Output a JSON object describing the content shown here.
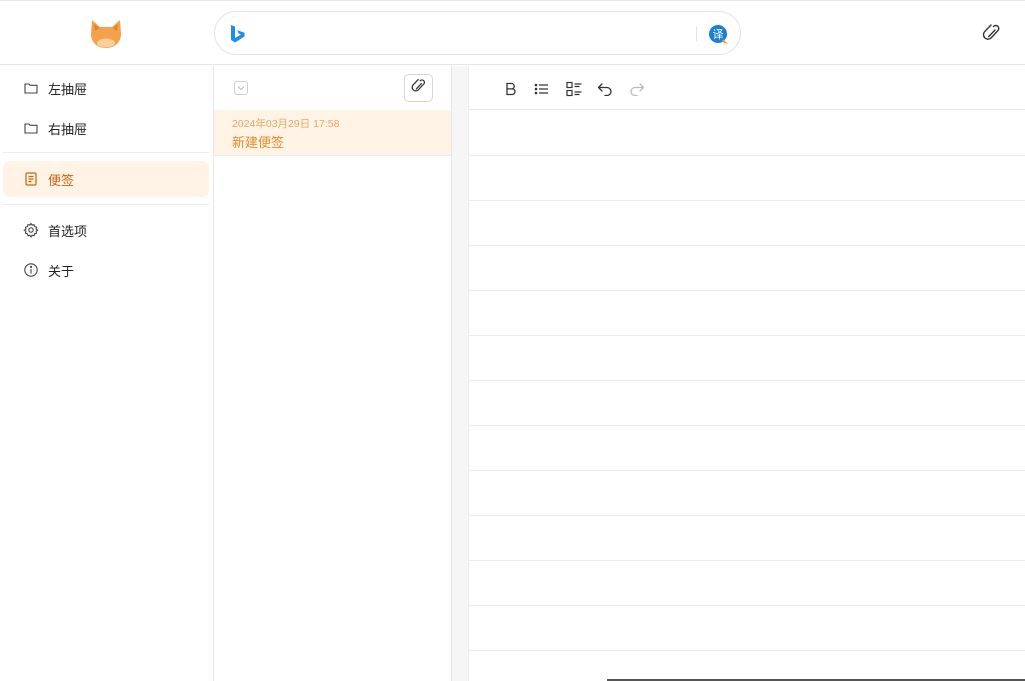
{
  "app": {
    "logo_icon": "cat-face-icon",
    "accent_color": "#c8640f"
  },
  "search": {
    "engine_icon": "bing-icon",
    "placeholder": "",
    "value": "",
    "translate_icon": "translate-icon"
  },
  "sidebar": {
    "items": [
      {
        "label": "左抽屉",
        "icon": "folder-icon"
      },
      {
        "label": "右抽屉",
        "icon": "folder-icon"
      },
      {
        "label": "便签",
        "icon": "note-icon",
        "active": true
      },
      {
        "label": "首选项",
        "icon": "gear-icon"
      },
      {
        "label": "关于",
        "icon": "info-icon"
      }
    ]
  },
  "notes": {
    "items": [
      {
        "date": "2024年03月29日 17:58",
        "title": "新建便签"
      }
    ]
  },
  "editor": {
    "toolbar": [
      "bold-icon",
      "bullet-list-icon",
      "task-list-icon",
      "undo-icon",
      "redo-icon"
    ]
  }
}
